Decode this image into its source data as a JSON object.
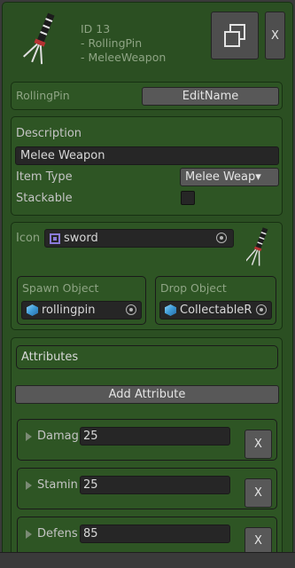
{
  "header": {
    "id_line": "ID 13",
    "name_line": "- RollingPin",
    "type_line": "- MeleeWeapon",
    "duplicate_icon": "duplicate-icon",
    "close_label": "X"
  },
  "name_panel": {
    "name_value": "RollingPin",
    "edit_button": "EditName"
  },
  "details": {
    "description_label": "Description",
    "description_value": "Melee Weapon",
    "item_type_label": "Item Type",
    "item_type_value": "Melee Weap▾",
    "stackable_label": "Stackable",
    "stackable_checked": false
  },
  "assets": {
    "icon_label": "Icon",
    "icon_value": "sword",
    "spawn_label": "Spawn Object",
    "spawn_value": "rollingpin",
    "drop_label": "Drop Object",
    "drop_value": "CollectableR"
  },
  "attributes": {
    "header": "Attributes",
    "add_button": "Add Attribute",
    "remove_label": "X",
    "items": [
      {
        "name": "Damag",
        "value": "25"
      },
      {
        "name": "Stamin",
        "value": "25"
      },
      {
        "name": "Defens",
        "value": "85"
      }
    ]
  },
  "colors": {
    "panel": "#2e5524",
    "panel_border": "#173012",
    "field": "#262626",
    "button": "#585858",
    "background": "#3a3a3a"
  }
}
